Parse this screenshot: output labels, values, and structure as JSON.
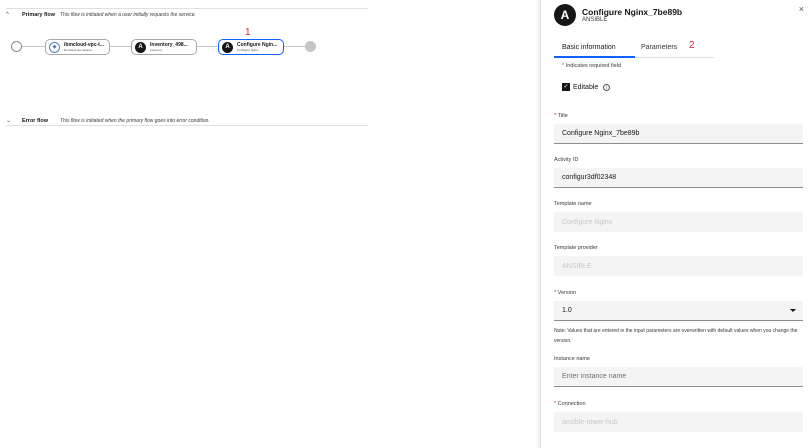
{
  "canvas": {
    "primary_flow": {
      "title": "Primary flow",
      "description": "This flow is initiated when a user initially requests the service.",
      "nodes": [
        {
          "title": "ibmcloud-vpc-t...",
          "subtitle": "ibmcloud-vpc-fastpat",
          "icon": "ibmcloud-icon"
        },
        {
          "title": "Inventory_498...",
          "subtitle": "Inventory",
          "icon": "ansible-icon"
        },
        {
          "title": "Configure Ngin...",
          "subtitle": "Configure Nginx",
          "icon": "ansible-icon"
        }
      ],
      "marker": "1"
    },
    "error_flow": {
      "title": "Error flow",
      "description": "This flow is initiated when the primary flow goes into error condition."
    }
  },
  "panel": {
    "logo": "A",
    "title": "Configure Nginx_7be89b",
    "subtitle": "ANSIBLE",
    "close": "×",
    "tabs": [
      "Basic information",
      "Parameters"
    ],
    "tab_marker": "2",
    "required_note": "Indicates required field",
    "editable_label": "Editable",
    "fields": {
      "title": {
        "label": "Title",
        "value": "Configure Nginx_7be89b"
      },
      "activity_id": {
        "label": "Activity ID",
        "value": "configur3df02348"
      },
      "template_name": {
        "label": "Template name",
        "value": "Configure Nginx"
      },
      "template_provider": {
        "label": "Template provider",
        "value": "ANSIBLE"
      },
      "version": {
        "label": "Version",
        "value": "1.0",
        "note": "Note: Values that are entered in the input parameters are overwritten with default values when you change the version."
      },
      "instance_name": {
        "label": "Instance name",
        "placeholder": "Enter instance name"
      },
      "connection": {
        "label": "Connection",
        "value": "ansible-tower-hub"
      }
    }
  },
  "colors": {
    "accent": "#0f62fe",
    "marker": "#da1e28"
  }
}
